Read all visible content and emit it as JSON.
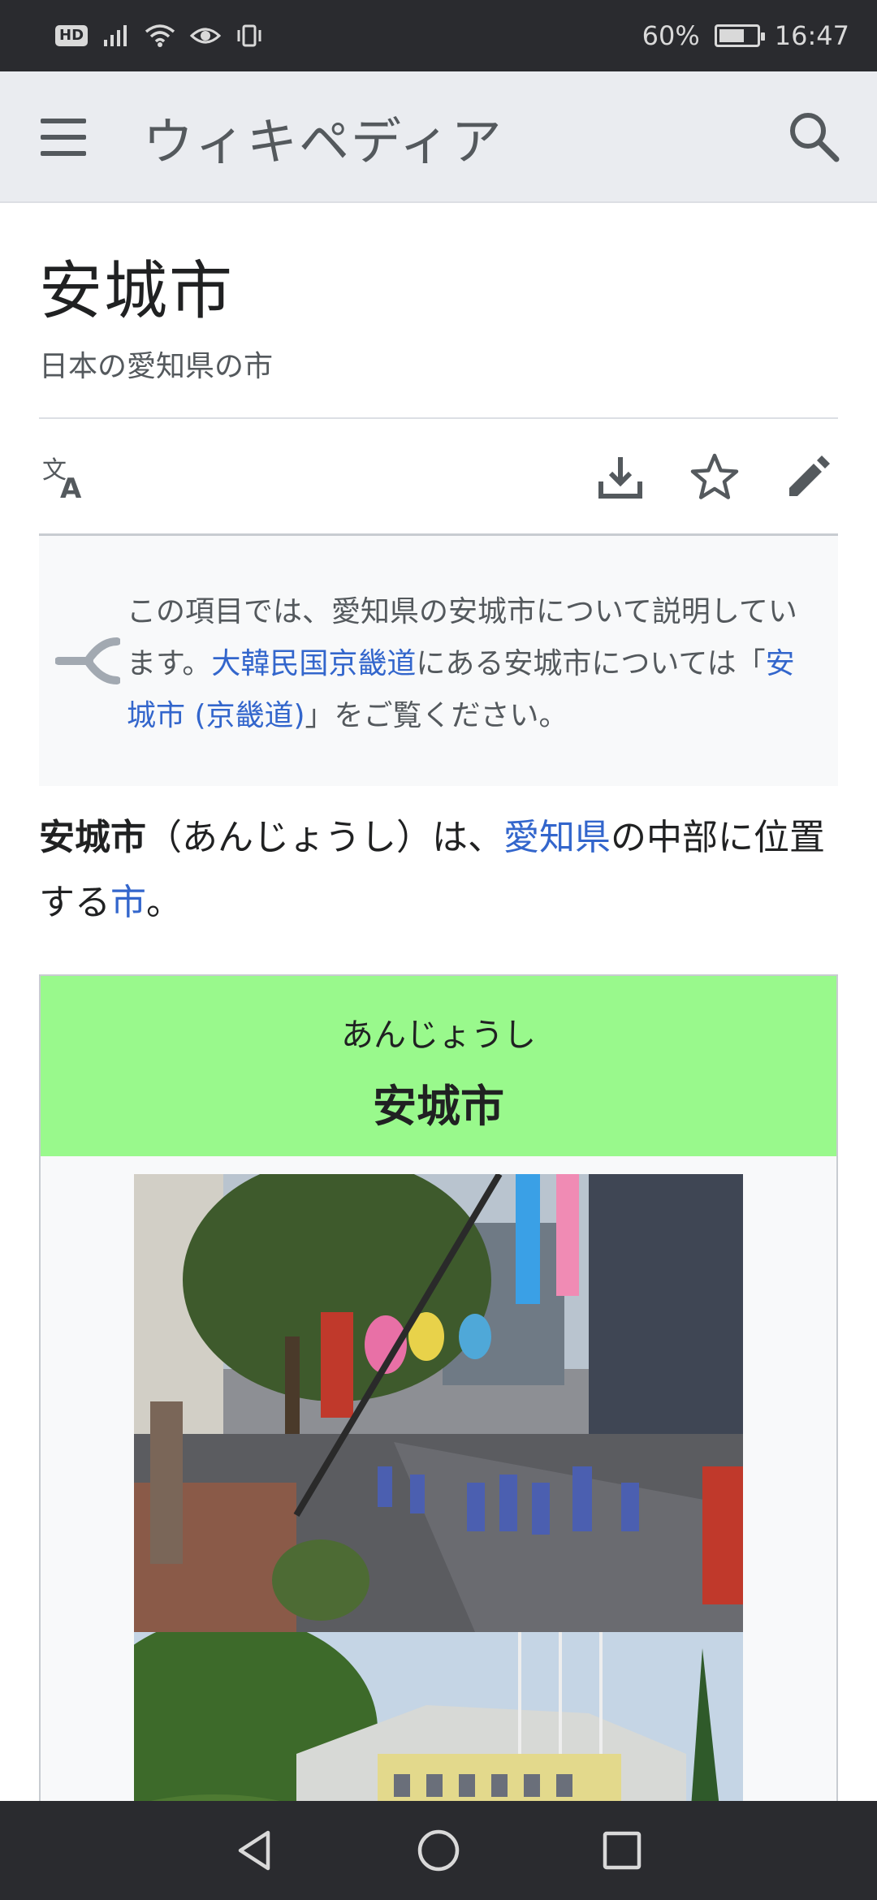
{
  "status_bar": {
    "hd": "HD",
    "battery_percent": "60%",
    "battery_level": 0.6,
    "time": "16:47",
    "icons": [
      "signal-icon",
      "wifi-icon",
      "eye-icon",
      "vibrate-icon",
      "battery-icon"
    ]
  },
  "header": {
    "title": "ウィキペディア",
    "icons": [
      "menu-icon",
      "search-icon"
    ]
  },
  "page": {
    "title": "安城市",
    "description": "日本の愛知県の市"
  },
  "actions": {
    "icons": [
      "language-icon",
      "download-icon",
      "star-icon",
      "edit-icon"
    ]
  },
  "hatnote": {
    "text1": "この項目では、愛知県の安城市について説明しています。",
    "link1": "大韓民国京畿道",
    "text2": "にある安城市については「",
    "link2": "安城市 (京畿道)",
    "text3": "」をご覧ください。"
  },
  "lead": {
    "bold": "安城市",
    "text1": "（あんじょうし）は、",
    "link1": "愛知県",
    "text2": "の中部に位置する",
    "link2": "市",
    "text3": "。"
  },
  "infobox": {
    "kana": "あんじょうし",
    "name": "安城市",
    "header_color": "#99f98c",
    "photos": [
      "tanabata-festival-photo",
      "building-photo"
    ]
  },
  "colors": {
    "link": "#3366cc",
    "header_bg": "#eaecf0",
    "status_bg": "#2a2b2f"
  },
  "nav_bar": {
    "icons": [
      "back-icon",
      "home-icon",
      "recents-icon"
    ]
  }
}
